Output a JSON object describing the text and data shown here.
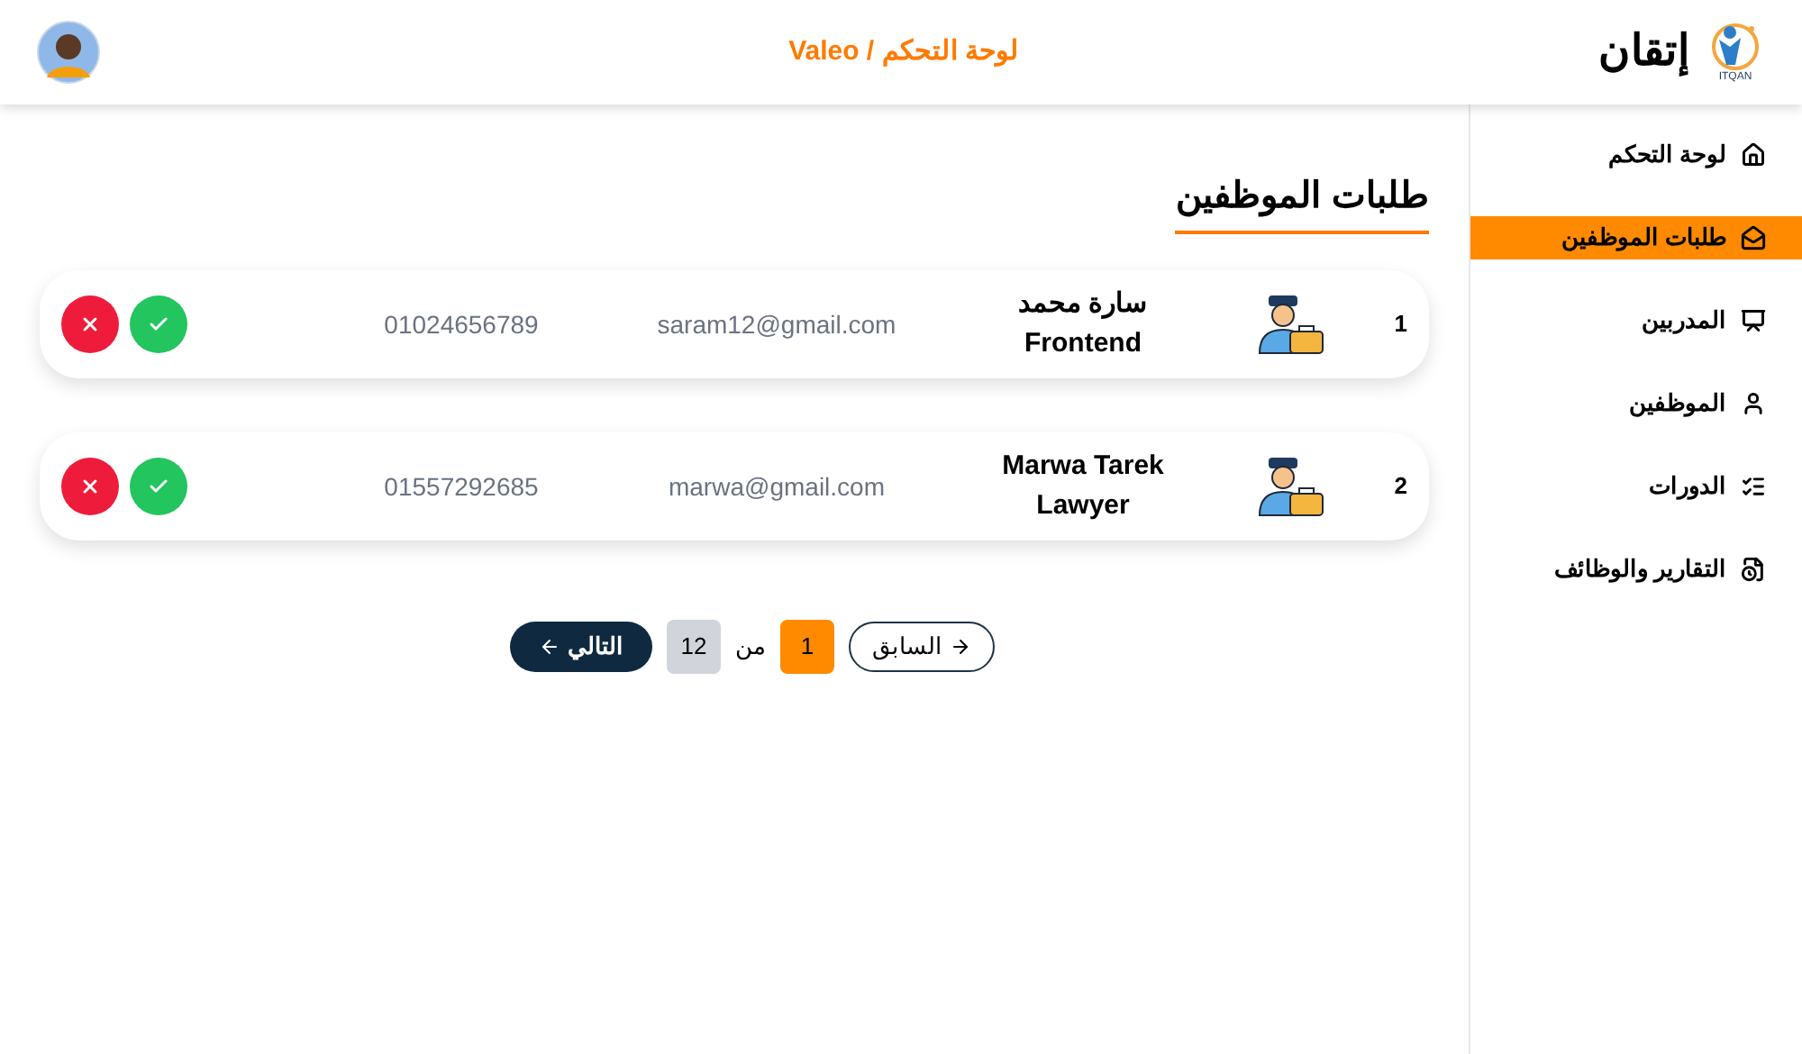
{
  "header": {
    "brand": "إتقان",
    "brand_caption": "ITQAN",
    "title": "لوحة التحكم / Valeo"
  },
  "sidebar": {
    "items": [
      {
        "label": "لوحة التحكم",
        "kind": "home",
        "selected": false
      },
      {
        "label": "طلبات الموظفين",
        "kind": "requests",
        "selected": true
      },
      {
        "label": "المدربين",
        "kind": "trainers",
        "selected": false
      },
      {
        "label": "الموظفين",
        "kind": "employees",
        "selected": false
      },
      {
        "label": "الدورات",
        "kind": "courses",
        "selected": false
      },
      {
        "label": "التقارير والوظائف",
        "kind": "reports",
        "selected": false
      }
    ]
  },
  "page_title": "طلبات الموظفين",
  "requests": [
    {
      "index": "1",
      "name": "سارة محمد",
      "role": "Frontend",
      "email": "saram12@gmail.com",
      "phone": "01024656789"
    },
    {
      "index": "2",
      "name": "Marwa Tarek",
      "role": "Lawyer",
      "email": "marwa@gmail.com",
      "phone": "01557292685"
    }
  ],
  "pagination": {
    "previous": "السابق",
    "current": "1",
    "of": "من",
    "total": "12",
    "next": "التالي"
  }
}
